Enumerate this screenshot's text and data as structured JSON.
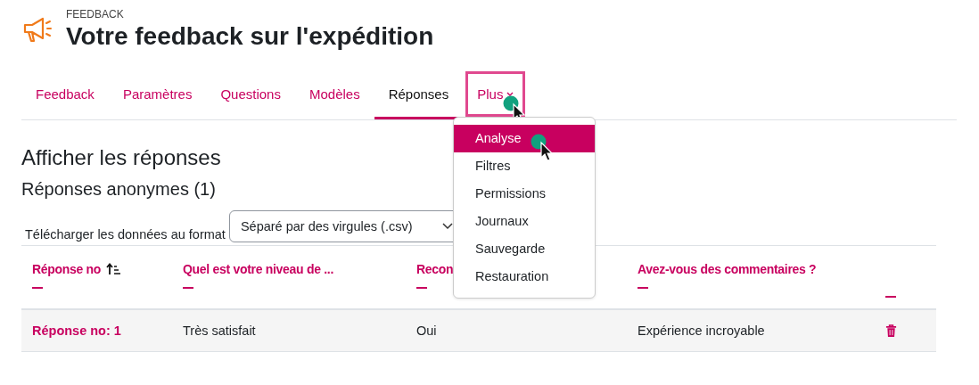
{
  "header": {
    "kicker": "FEEDBACK",
    "title": "Votre feedback sur l'expédition"
  },
  "tabs": [
    {
      "label": "Feedback",
      "selected": false,
      "dropdown": false,
      "highlighted": false,
      "pointer": false
    },
    {
      "label": "Paramètres",
      "selected": false,
      "dropdown": false,
      "highlighted": false,
      "pointer": false
    },
    {
      "label": "Questions",
      "selected": false,
      "dropdown": false,
      "highlighted": false,
      "pointer": false
    },
    {
      "label": "Modèles",
      "selected": false,
      "dropdown": false,
      "highlighted": false,
      "pointer": false
    },
    {
      "label": "Réponses",
      "selected": true,
      "dropdown": false,
      "highlighted": false,
      "pointer": false
    },
    {
      "label": "Plus",
      "selected": false,
      "dropdown": true,
      "highlighted": true,
      "pointer": true
    }
  ],
  "menu": {
    "items": [
      {
        "label": "Analyse",
        "selected": true,
        "pointer": true
      },
      {
        "label": "Filtres",
        "selected": false,
        "pointer": false
      },
      {
        "label": "Permissions",
        "selected": false,
        "pointer": false
      },
      {
        "label": "Journaux",
        "selected": false,
        "pointer": false
      },
      {
        "label": "Sauvegarde",
        "selected": false,
        "pointer": false
      },
      {
        "label": "Restauration",
        "selected": false,
        "pointer": false
      }
    ]
  },
  "page_title": "Afficher les réponses",
  "section_title": "Réponses anonymes (1)",
  "download": {
    "label": "Télécharger les données au format",
    "value": "Séparé par des virgules (.csv)"
  },
  "table": {
    "columns": [
      {
        "label": "Réponse no",
        "sorted": true
      },
      {
        "label": "Quel est votre niveau de ...",
        "sorted": false
      },
      {
        "label": "Recon",
        "sorted": false
      },
      {
        "label": "Avez-vous des commentaires ?",
        "sorted": false
      },
      {}
    ],
    "rows": [
      {
        "cells": [
          "Réponse no: 1",
          "Très satisfait",
          "Oui",
          "Expérience incroyable"
        ],
        "deletable": true
      }
    ]
  }
}
